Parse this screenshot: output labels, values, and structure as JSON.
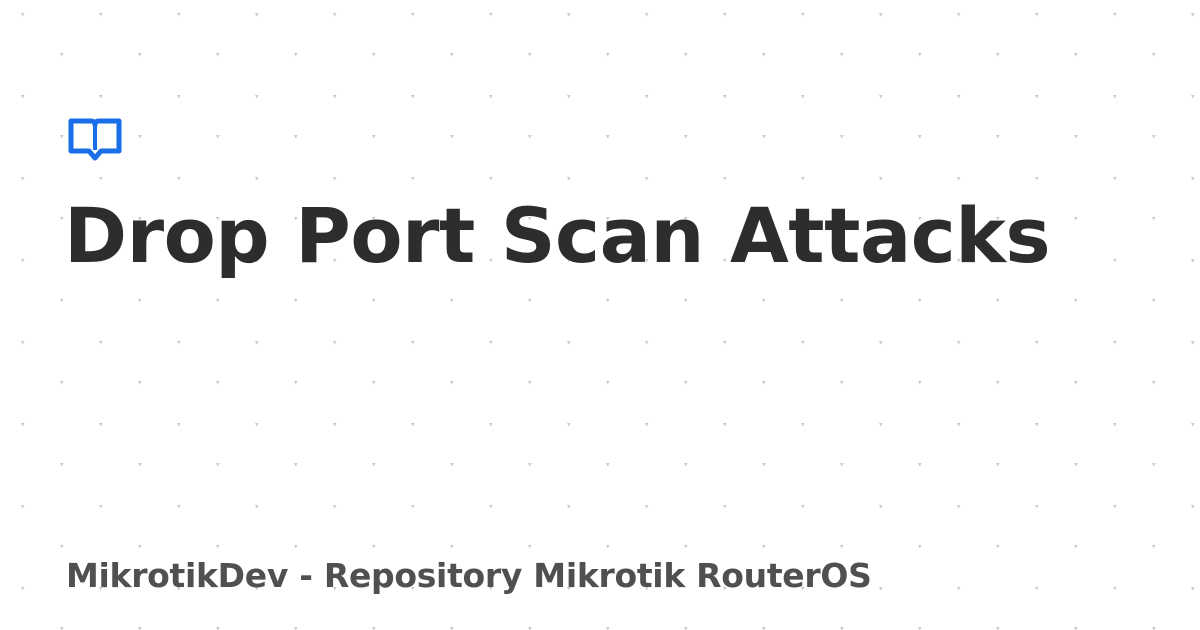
{
  "page": {
    "title": "Drop Port Scan Attacks",
    "site_name": "MikrotikDev - Repository Mikrotik RouterOS"
  },
  "logo": {
    "icon": "open-book-icon",
    "color": "#1a6ee8"
  },
  "colors": {
    "background": "#ffffff",
    "title_text": "#2d2d2d",
    "footer_text": "#505050",
    "dot_pattern": "#c8c8c8"
  }
}
